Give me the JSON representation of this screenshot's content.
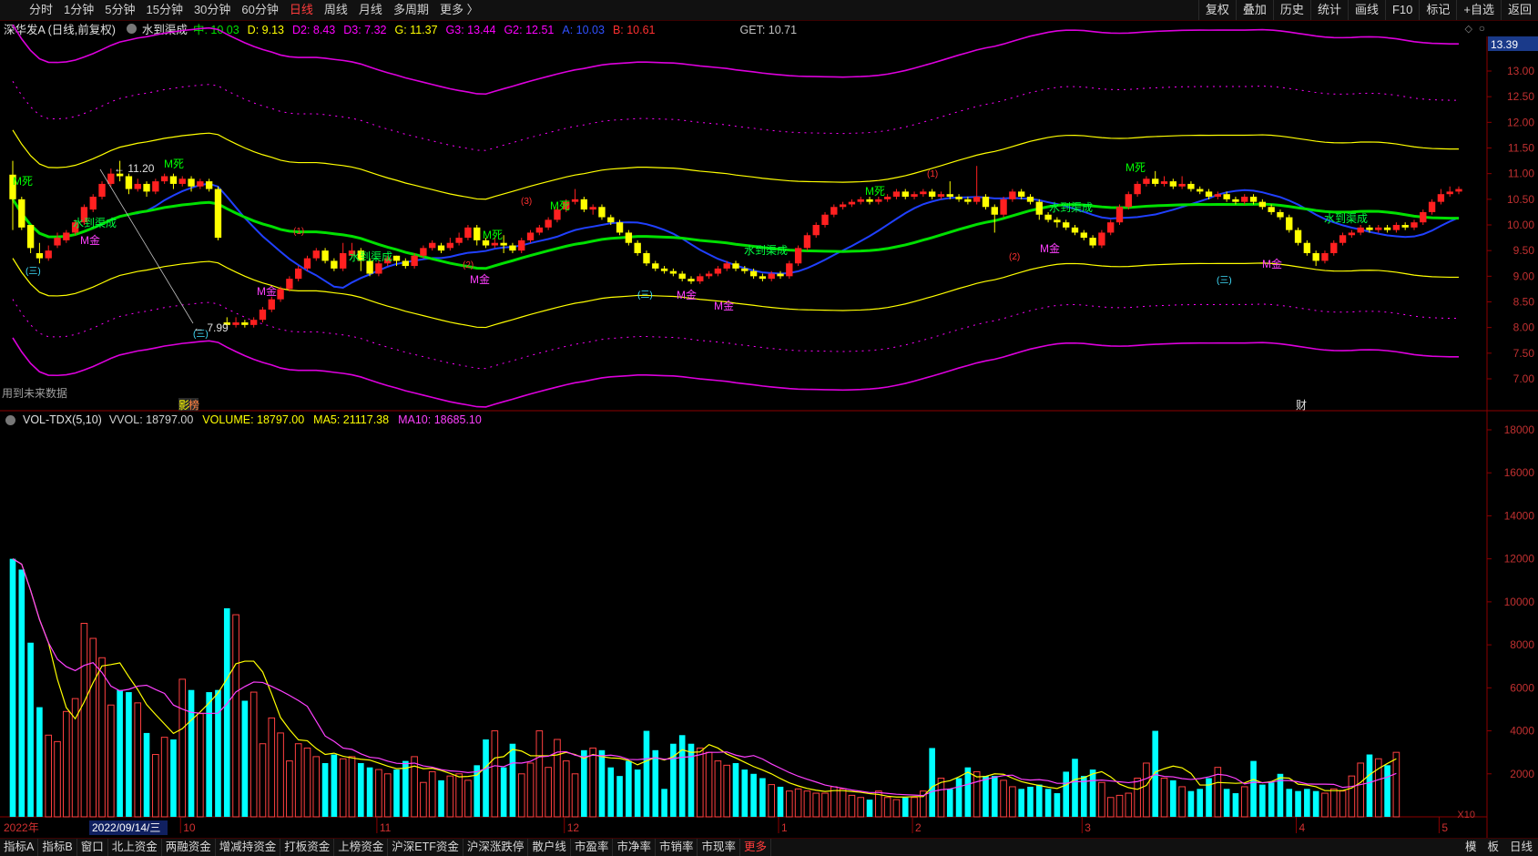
{
  "topbar": {
    "periods": [
      "分时",
      "1分钟",
      "5分钟",
      "15分钟",
      "30分钟",
      "60分钟",
      "日线",
      "周线",
      "月线",
      "多周期",
      "更多 〉"
    ],
    "active_period": "日线",
    "tools": [
      "复权",
      "叠加",
      "历史",
      "统计",
      "画线",
      "F10",
      "标记",
      "+自选",
      "返回"
    ]
  },
  "info": {
    "stock_name": "深华发A (日线,前复权)",
    "indicator_name": "水到渠成",
    "values": [
      {
        "text": "中: 10.03",
        "color": "#00e000"
      },
      {
        "text": "D: 9.13",
        "color": "#ffff00"
      },
      {
        "text": "D2: 8.43",
        "color": "#ff00ff"
      },
      {
        "text": "D3: 7.32",
        "color": "#ff00ff"
      },
      {
        "text": "G: 11.37",
        "color": "#ffff00"
      },
      {
        "text": "G3: 13.44",
        "color": "#ff00ff"
      },
      {
        "text": "G2: 12.51",
        "color": "#ff00ff"
      },
      {
        "text": "A: 10.03",
        "color": "#3050ff"
      },
      {
        "text": "B: 10.61",
        "color": "#ff3030"
      },
      {
        "text": "GET: 10.71",
        "color": "#c0c0c0"
      }
    ],
    "diamond": "◇",
    "circle": "○"
  },
  "price_panel": {
    "current_price_tag": "13.39",
    "axis_ticks": [
      "13.00",
      "12.50",
      "12.00",
      "11.50",
      "11.00",
      "10.50",
      "10.00",
      "9.50",
      "9.00",
      "8.50",
      "8.00",
      "7.50",
      "7.00"
    ],
    "note": "用到未来数据",
    "high_label": "11.20",
    "low_label": "7.99",
    "event_markers": [
      "影",
      "榜",
      "财"
    ],
    "signals": {
      "m_si": "M死",
      "m_jin": "M金",
      "shui": "水到渠成",
      "s1": "(1)",
      "s2": "(2)",
      "s3": "(3)",
      "s3e": "(三)"
    }
  },
  "volume_panel": {
    "name": "VOL-TDX(5,10)",
    "values": [
      {
        "text": "VVOL: 18797.00",
        "color": "#d0d0d0"
      },
      {
        "text": "VOLUME: 18797.00",
        "color": "#ffff00"
      },
      {
        "text": "MA5: 21117.38",
        "color": "#ffff00"
      },
      {
        "text": "MA10: 18685.10",
        "color": "#ff40ff"
      }
    ],
    "axis_ticks": [
      "18000",
      "16000",
      "14000",
      "12000",
      "10000",
      "8000",
      "6000",
      "4000",
      "2000"
    ],
    "unit": "X10"
  },
  "time_axis": {
    "year_label": "2022年",
    "cursor_date": "2022/09/14/三",
    "months": [
      "10",
      "11",
      "12",
      "1",
      "2",
      "3",
      "4",
      "5"
    ]
  },
  "statusbar": {
    "tabs": [
      "指标A",
      "指标B",
      "窗口",
      "北上资金",
      "两融资金",
      "增减持资金",
      "打板资金",
      "上榜资金",
      "沪深ETF资金",
      "沪深涨跌停",
      "散户线",
      "市盈率",
      "市净率",
      "市销率",
      "市现率",
      "更多"
    ],
    "right": [
      "模",
      "板",
      "日线"
    ]
  },
  "chart_data": {
    "type": "candlestick",
    "price_axis": {
      "min": 7.0,
      "max": 13.0
    },
    "volume_axis": {
      "min": 0,
      "max": 18000,
      "unit": "X10"
    },
    "candles": [
      [
        10.98,
        10.5,
        11.25,
        9.9
      ],
      [
        10.5,
        9.95,
        10.55,
        9.9
      ],
      [
        10.0,
        9.55,
        10.0,
        9.45
      ],
      [
        9.45,
        9.35,
        9.65,
        9.25
      ],
      [
        9.35,
        9.5,
        9.6,
        9.3
      ],
      [
        9.6,
        9.75,
        9.85,
        9.55
      ],
      [
        9.7,
        9.85,
        9.9,
        9.65
      ],
      [
        9.85,
        10.05,
        10.1,
        9.8
      ],
      [
        10.05,
        10.35,
        10.4,
        10.0
      ],
      [
        10.3,
        10.55,
        10.6,
        10.25
      ],
      [
        10.55,
        10.8,
        10.85,
        10.5
      ],
      [
        10.8,
        11.0,
        11.1,
        10.75
      ],
      [
        11.0,
        10.95,
        11.25,
        10.85
      ],
      [
        10.95,
        10.7,
        11.0,
        10.6
      ],
      [
        10.7,
        10.8,
        10.9,
        10.65
      ],
      [
        10.8,
        10.65,
        10.85,
        10.55
      ],
      [
        10.65,
        10.85,
        10.9,
        10.6
      ],
      [
        10.85,
        10.95,
        11.0,
        10.8
      ],
      [
        10.95,
        10.8,
        11.0,
        10.7
      ],
      [
        10.8,
        10.9,
        10.95,
        10.75
      ],
      [
        10.9,
        10.75,
        10.95,
        10.65
      ],
      [
        10.75,
        10.85,
        10.9,
        10.7
      ],
      [
        10.85,
        10.7,
        10.9,
        10.65
      ],
      [
        10.7,
        9.75,
        10.75,
        9.7
      ],
      [
        8.1,
        8.05,
        8.2,
        7.99
      ],
      [
        8.05,
        8.1,
        8.2,
        8.0
      ],
      [
        8.1,
        8.05,
        8.15,
        8.0
      ],
      [
        8.05,
        8.15,
        8.2,
        8.0
      ],
      [
        8.15,
        8.35,
        8.4,
        8.1
      ],
      [
        8.35,
        8.55,
        8.6,
        8.3
      ],
      [
        8.55,
        8.75,
        8.8,
        8.5
      ],
      [
        8.75,
        8.95,
        9.0,
        8.7
      ],
      [
        8.95,
        9.15,
        9.2,
        8.9
      ],
      [
        9.15,
        9.35,
        9.4,
        9.1
      ],
      [
        9.35,
        9.5,
        9.55,
        9.3
      ],
      [
        9.5,
        9.3,
        9.55,
        9.25
      ],
      [
        9.3,
        9.15,
        9.35,
        9.1
      ],
      [
        9.15,
        9.45,
        9.65,
        9.1
      ],
      [
        9.4,
        9.5,
        9.65,
        9.35
      ],
      [
        9.5,
        9.3,
        9.55,
        9.1
      ],
      [
        9.3,
        9.05,
        9.35,
        9.0
      ],
      [
        9.05,
        9.25,
        9.3,
        9.0
      ],
      [
        9.25,
        9.35,
        9.4,
        9.2
      ],
      [
        9.4,
        9.3,
        9.4,
        9.2
      ],
      [
        9.3,
        9.2,
        9.35,
        9.15
      ],
      [
        9.2,
        9.4,
        9.45,
        9.15
      ],
      [
        9.4,
        9.55,
        9.6,
        9.35
      ],
      [
        9.55,
        9.65,
        9.7,
        9.5
      ],
      [
        9.6,
        9.5,
        9.65,
        9.45
      ],
      [
        9.55,
        9.65,
        9.75,
        9.5
      ],
      [
        9.65,
        9.75,
        9.85,
        9.6
      ],
      [
        9.75,
        9.95,
        10.0,
        9.7
      ],
      [
        9.95,
        9.7,
        10.0,
        9.6
      ],
      [
        9.7,
        9.6,
        9.75,
        9.55
      ],
      [
        9.6,
        9.65,
        9.75,
        9.55
      ],
      [
        9.65,
        9.6,
        9.8,
        9.45
      ],
      [
        9.6,
        9.5,
        9.65,
        9.45
      ],
      [
        9.5,
        9.7,
        9.75,
        9.45
      ],
      [
        9.7,
        9.85,
        9.9,
        9.65
      ],
      [
        9.85,
        9.95,
        10.0,
        9.8
      ],
      [
        9.95,
        10.1,
        10.15,
        9.9
      ],
      [
        10.1,
        10.3,
        10.35,
        10.05
      ],
      [
        10.3,
        10.45,
        10.5,
        10.25
      ],
      [
        10.45,
        10.5,
        10.7,
        10.4
      ],
      [
        10.5,
        10.3,
        10.55,
        10.25
      ],
      [
        10.3,
        10.35,
        10.4,
        10.2
      ],
      [
        10.35,
        10.15,
        10.4,
        10.1
      ],
      [
        10.15,
        10.05,
        10.2,
        10.0
      ],
      [
        10.05,
        9.85,
        10.1,
        9.8
      ],
      [
        9.85,
        9.65,
        9.9,
        9.6
      ],
      [
        9.65,
        9.45,
        9.7,
        9.4
      ],
      [
        9.45,
        9.25,
        9.5,
        9.2
      ],
      [
        9.25,
        9.15,
        9.3,
        9.1
      ],
      [
        9.15,
        9.1,
        9.2,
        9.05
      ],
      [
        9.1,
        9.05,
        9.15,
        9.0
      ],
      [
        9.05,
        8.95,
        9.1,
        8.9
      ],
      [
        8.95,
        8.9,
        9.0,
        8.85
      ],
      [
        8.9,
        9.0,
        9.05,
        8.85
      ],
      [
        9.0,
        9.05,
        9.1,
        8.95
      ],
      [
        9.05,
        9.15,
        9.2,
        9.0
      ],
      [
        9.15,
        9.25,
        9.3,
        9.1
      ],
      [
        9.25,
        9.15,
        9.3,
        9.1
      ],
      [
        9.15,
        9.1,
        9.2,
        9.05
      ],
      [
        9.1,
        9.0,
        9.15,
        8.95
      ],
      [
        9.0,
        8.95,
        9.05,
        8.9
      ],
      [
        8.95,
        9.05,
        9.1,
        8.9
      ],
      [
        9.05,
        9.0,
        9.1,
        8.95
      ],
      [
        9.0,
        9.25,
        9.3,
        8.95
      ],
      [
        9.25,
        9.55,
        9.6,
        9.2
      ],
      [
        9.55,
        9.8,
        9.85,
        9.5
      ],
      [
        9.8,
        10.0,
        10.05,
        9.75
      ],
      [
        10.0,
        10.2,
        10.25,
        9.95
      ],
      [
        10.2,
        10.35,
        10.4,
        10.15
      ],
      [
        10.35,
        10.4,
        10.45,
        10.3
      ],
      [
        10.4,
        10.45,
        10.5,
        10.35
      ],
      [
        10.45,
        10.5,
        10.55,
        10.4
      ],
      [
        10.5,
        10.45,
        10.55,
        10.4
      ],
      [
        10.45,
        10.5,
        10.55,
        10.4
      ],
      [
        10.5,
        10.55,
        10.6,
        10.45
      ],
      [
        10.55,
        10.65,
        10.7,
        10.5
      ],
      [
        10.65,
        10.55,
        10.7,
        10.5
      ],
      [
        10.55,
        10.6,
        10.65,
        10.5
      ],
      [
        10.6,
        10.65,
        10.7,
        10.55
      ],
      [
        10.65,
        10.55,
        10.7,
        10.5
      ],
      [
        10.55,
        10.6,
        10.65,
        10.5
      ],
      [
        10.6,
        10.55,
        10.85,
        10.5
      ],
      [
        10.55,
        10.5,
        10.6,
        10.45
      ],
      [
        10.5,
        10.45,
        10.55,
        10.4
      ],
      [
        10.45,
        10.55,
        11.15,
        10.4
      ],
      [
        10.55,
        10.35,
        10.6,
        10.3
      ],
      [
        10.35,
        10.2,
        10.4,
        9.85
      ],
      [
        10.2,
        10.5,
        10.55,
        10.15
      ],
      [
        10.5,
        10.65,
        10.7,
        10.45
      ],
      [
        10.65,
        10.55,
        10.7,
        10.5
      ],
      [
        10.55,
        10.45,
        10.6,
        10.4
      ],
      [
        10.45,
        10.2,
        10.5,
        10.1
      ],
      [
        10.2,
        10.1,
        10.25,
        10.05
      ],
      [
        10.1,
        10.05,
        10.15,
        9.95
      ],
      [
        10.05,
        9.95,
        10.1,
        9.9
      ],
      [
        9.95,
        9.85,
        10.0,
        9.8
      ],
      [
        9.85,
        9.75,
        9.9,
        9.7
      ],
      [
        9.75,
        9.6,
        9.8,
        9.55
      ],
      [
        9.6,
        9.85,
        9.9,
        9.55
      ],
      [
        9.85,
        10.05,
        10.1,
        9.8
      ],
      [
        10.05,
        10.35,
        10.4,
        10.0
      ],
      [
        10.35,
        10.6,
        10.65,
        10.3
      ],
      [
        10.6,
        10.8,
        10.85,
        10.55
      ],
      [
        10.8,
        10.9,
        10.95,
        10.75
      ],
      [
        10.9,
        10.8,
        11.05,
        10.75
      ],
      [
        10.8,
        10.85,
        10.95,
        10.75
      ],
      [
        10.85,
        10.75,
        10.9,
        10.7
      ],
      [
        10.75,
        10.8,
        10.95,
        10.7
      ],
      [
        10.8,
        10.7,
        10.85,
        10.65
      ],
      [
        10.7,
        10.65,
        10.75,
        10.6
      ],
      [
        10.65,
        10.55,
        10.7,
        10.5
      ],
      [
        10.55,
        10.6,
        10.65,
        10.5
      ],
      [
        10.6,
        10.5,
        10.65,
        10.45
      ],
      [
        10.5,
        10.45,
        10.55,
        10.4
      ],
      [
        10.45,
        10.55,
        10.6,
        10.4
      ],
      [
        10.55,
        10.45,
        10.6,
        10.4
      ],
      [
        10.45,
        10.35,
        10.5,
        10.3
      ],
      [
        10.35,
        10.25,
        10.4,
        10.2
      ],
      [
        10.25,
        10.15,
        10.3,
        10.1
      ],
      [
        10.15,
        9.9,
        10.2,
        9.85
      ],
      [
        9.9,
        9.65,
        9.95,
        9.6
      ],
      [
        9.65,
        9.45,
        9.7,
        9.4
      ],
      [
        9.45,
        9.3,
        9.5,
        9.2
      ],
      [
        9.3,
        9.45,
        9.5,
        9.25
      ],
      [
        9.45,
        9.65,
        9.7,
        9.4
      ],
      [
        9.65,
        9.8,
        9.85,
        9.6
      ],
      [
        9.8,
        9.85,
        9.9,
        9.75
      ],
      [
        9.85,
        9.95,
        10.0,
        9.8
      ],
      [
        9.95,
        9.9,
        10.0,
        9.85
      ],
      [
        9.9,
        9.95,
        10.0,
        9.85
      ],
      [
        9.95,
        9.9,
        10.0,
        9.85
      ],
      [
        9.9,
        10.0,
        10.05,
        9.85
      ],
      [
        10.0,
        9.95,
        10.05,
        9.9
      ],
      [
        9.95,
        10.05,
        10.1,
        9.9
      ],
      [
        10.05,
        10.25,
        10.3,
        10.0
      ],
      [
        10.25,
        10.45,
        10.5,
        10.2
      ],
      [
        10.45,
        10.6,
        10.7,
        10.4
      ],
      [
        10.6,
        10.65,
        10.75,
        10.55
      ],
      [
        10.65,
        10.7,
        10.75,
        10.6
      ]
    ],
    "volumes": [
      12000,
      11500,
      8100,
      5100,
      3800,
      3500,
      4900,
      5500,
      9000,
      8300,
      7400,
      5200,
      5900,
      5800,
      5300,
      3900,
      2900,
      3700,
      3600,
      6400,
      5900,
      4800,
      5800,
      5900,
      9700,
      9400,
      5400,
      5800,
      3400,
      4600,
      3900,
      2600,
      3400,
      3200,
      2800,
      2500,
      2900,
      2700,
      2800,
      2500,
      2300,
      2200,
      2000,
      2200,
      2600,
      2800,
      1600,
      2100,
      1700,
      1900,
      2000,
      1700,
      2400,
      3600,
      4000,
      2300,
      3400,
      2000,
      2500,
      4000,
      2300,
      3600,
      2600,
      2000,
      3100,
      3200,
      3100,
      2300,
      1900,
      2600,
      2200,
      4000,
      3100,
      1300,
      3400,
      3800,
      3400,
      3200,
      3000,
      2600,
      2400,
      2500,
      2200,
      2000,
      1800,
      1500,
      1400,
      1200,
      1300,
      1200,
      1100,
      1100,
      1400,
      1300,
      1000,
      900,
      800,
      1200,
      900,
      800,
      900,
      900,
      1200,
      3200,
      1800,
      1300,
      1800,
      2300,
      2100,
      1900,
      1900,
      1700,
      1400,
      1300,
      1400,
      1500,
      1300,
      1100,
      2100,
      2700,
      1900,
      2200,
      1600,
      900,
      1000,
      1100,
      1800,
      2500,
      4000,
      1800,
      1700,
      1400,
      1200,
      1300,
      1800,
      2300,
      1300,
      1100,
      1400,
      2600,
      1500,
      1600,
      2000,
      1300,
      1200,
      1300,
      1200,
      1100,
      1300,
      1200,
      1900,
      2500,
      2900,
      2700,
      2400,
      3000
    ]
  }
}
